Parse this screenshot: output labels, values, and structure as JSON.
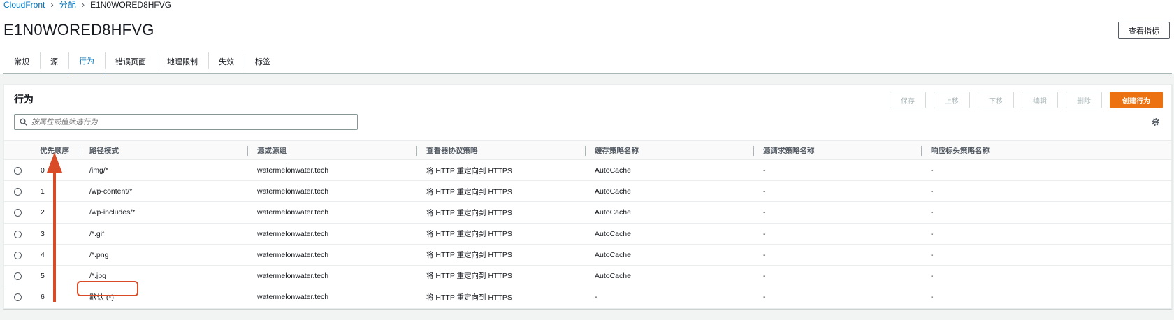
{
  "breadcrumb": {
    "root": "CloudFront",
    "section": "分配",
    "current": "E1N0WORED8HFVG"
  },
  "page_title": "E1N0WORED8HFVG",
  "header_button": "查看指标",
  "tabs": [
    {
      "label": "常规",
      "active": false
    },
    {
      "label": "源",
      "active": false
    },
    {
      "label": "行为",
      "active": true
    },
    {
      "label": "错误页面",
      "active": false
    },
    {
      "label": "地理限制",
      "active": false
    },
    {
      "label": "失效",
      "active": false
    },
    {
      "label": "标签",
      "active": false
    }
  ],
  "panel": {
    "title": "行为",
    "actions": {
      "save": "保存",
      "move_up": "上移",
      "move_down": "下移",
      "edit": "编辑",
      "delete": "删除",
      "create": "创建行为"
    },
    "filter_placeholder": "按属性或值筛选行为",
    "columns": [
      "优先顺序",
      "路径模式",
      "源或源组",
      "查看器协议策略",
      "缓存策略名称",
      "源请求策略名称",
      "响应标头策略名称"
    ],
    "rows": [
      {
        "priority": "0",
        "path": "/img/*",
        "origin": "watermelonwater.tech",
        "viewer_policy": "将 HTTP 重定向到 HTTPS",
        "cache_policy": "AutoCache",
        "origin_request_policy": "-",
        "response_headers_policy": "-"
      },
      {
        "priority": "1",
        "path": "/wp-content/*",
        "origin": "watermelonwater.tech",
        "viewer_policy": "将 HTTP 重定向到 HTTPS",
        "cache_policy": "AutoCache",
        "origin_request_policy": "-",
        "response_headers_policy": "-"
      },
      {
        "priority": "2",
        "path": "/wp-includes/*",
        "origin": "watermelonwater.tech",
        "viewer_policy": "将 HTTP 重定向到 HTTPS",
        "cache_policy": "AutoCache",
        "origin_request_policy": "-",
        "response_headers_policy": "-"
      },
      {
        "priority": "3",
        "path": "/*.gif",
        "origin": "watermelonwater.tech",
        "viewer_policy": "将 HTTP 重定向到 HTTPS",
        "cache_policy": "AutoCache",
        "origin_request_policy": "-",
        "response_headers_policy": "-"
      },
      {
        "priority": "4",
        "path": "/*.png",
        "origin": "watermelonwater.tech",
        "viewer_policy": "将 HTTP 重定向到 HTTPS",
        "cache_policy": "AutoCache",
        "origin_request_policy": "-",
        "response_headers_policy": "-"
      },
      {
        "priority": "5",
        "path": "/*.jpg",
        "origin": "watermelonwater.tech",
        "viewer_policy": "将 HTTP 重定向到 HTTPS",
        "cache_policy": "AutoCache",
        "origin_request_policy": "-",
        "response_headers_policy": "-"
      },
      {
        "priority": "6",
        "path": "默认 (*)",
        "origin": "watermelonwater.tech",
        "viewer_policy": "将 HTTP 重定向到 HTTPS",
        "cache_policy": "-",
        "origin_request_policy": "-",
        "response_headers_policy": "-"
      }
    ]
  },
  "colors": {
    "link": "#0073bb",
    "primary": "#ec7211",
    "annotation": "#d94b27"
  },
  "icons": {
    "breadcrumb_separator": "chevron-right-icon",
    "filter": "search-icon",
    "settings": "gear-icon",
    "annotation": "up-arrow-annotation"
  }
}
